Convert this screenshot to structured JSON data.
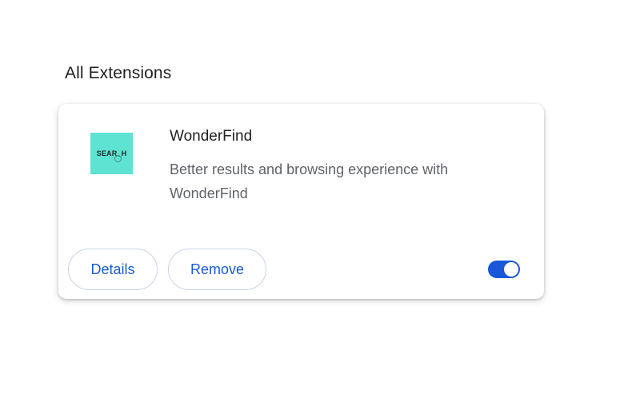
{
  "section": {
    "title": "All Extensions"
  },
  "extension": {
    "icon_text": "SEAR_H",
    "icon_bg_color": "#5ee3d2",
    "name": "WonderFind",
    "description": "Better results and browsing experience with WonderFind",
    "details_label": "Details",
    "remove_label": "Remove",
    "enabled": true,
    "accent_color": "#1a56d8"
  }
}
